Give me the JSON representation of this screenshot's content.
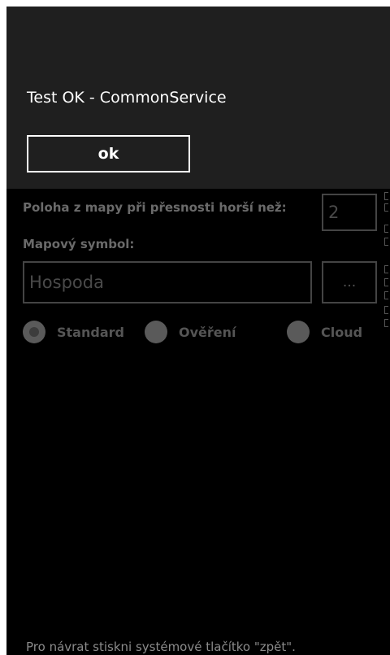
{
  "message_box": {
    "text": "Test OK - CommonService",
    "ok_label": "ok"
  },
  "form": {
    "accuracy_label": "Poloha z mapy při přesnosti horší než:",
    "accuracy_value": "2",
    "symbol_label": "Mapový symbol:",
    "symbol_value": "Hospoda",
    "browse_label": "...",
    "radio_options": [
      {
        "label": "Standard",
        "selected": true
      },
      {
        "label": "Ověření",
        "selected": false
      },
      {
        "label": "Cloud",
        "selected": false
      }
    ]
  },
  "footer": {
    "hint": "Pro návrat stiskni systémové tlačítko \"zpět\"."
  },
  "colors": {
    "background": "#000000",
    "message_box": "#1f1f1f",
    "text": "#ffffff"
  }
}
